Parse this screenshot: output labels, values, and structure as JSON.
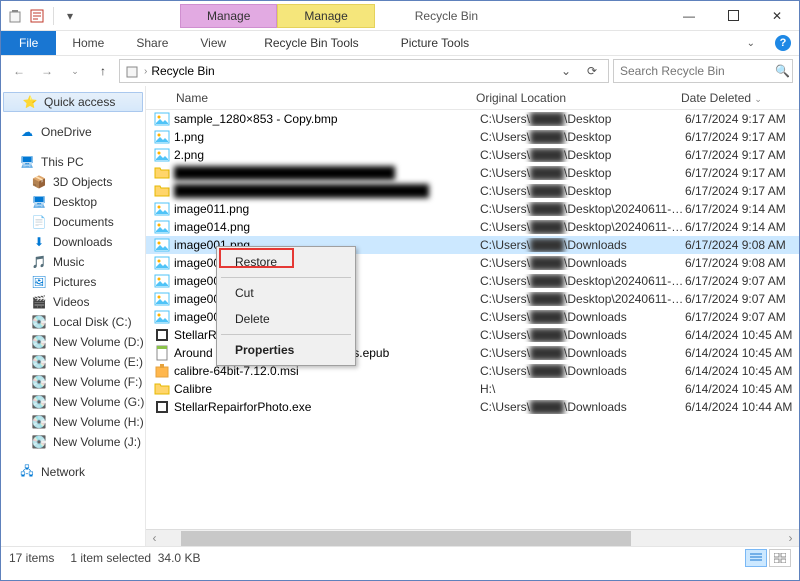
{
  "window": {
    "title": "Recycle Bin"
  },
  "title_tabs": {
    "pink": "Manage",
    "yellow": "Manage"
  },
  "ribbon": {
    "file": "File",
    "home": "Home",
    "share": "Share",
    "view": "View",
    "rbtools": "Recycle Bin Tools",
    "pictools": "Picture Tools"
  },
  "address": {
    "location": "Recycle Bin"
  },
  "search": {
    "placeholder": "Search Recycle Bin"
  },
  "sidebar": {
    "quick_access": "Quick access",
    "onedrive": "OneDrive",
    "this_pc": "This PC",
    "items": [
      "3D Objects",
      "Desktop",
      "Documents",
      "Downloads",
      "Music",
      "Pictures",
      "Videos",
      "Local Disk (C:)",
      "New Volume (D:)",
      "New Volume (E:)",
      "New Volume (F:)",
      "New Volume (G:)",
      "New Volume (H:)",
      "New Volume (J:)"
    ],
    "network": "Network"
  },
  "columns": {
    "name": "Name",
    "loc": "Original Location",
    "date": "Date Deleted"
  },
  "files": [
    {
      "icon": "img",
      "name": "sample_1280×853 - Copy.bmp",
      "loc": "C:\\Users\\████\\Desktop",
      "date": "6/17/2024 9:17 AM"
    },
    {
      "icon": "img",
      "name": "1.png",
      "loc": "C:\\Users\\████\\Desktop",
      "date": "6/17/2024 9:17 AM"
    },
    {
      "icon": "img",
      "name": "2.png",
      "loc": "C:\\Users\\████\\Desktop",
      "date": "6/17/2024 9:17 AM"
    },
    {
      "icon": "folder",
      "name": "██████████████████████████",
      "loc": "C:\\Users\\████\\Desktop",
      "date": "6/17/2024 9:17 AM",
      "blur": true
    },
    {
      "icon": "folder",
      "name": "██████████████████████████████",
      "loc": "C:\\Users\\████\\Desktop",
      "date": "6/17/2024 9:17 AM",
      "blur": true
    },
    {
      "icon": "img",
      "name": "image011.png",
      "loc": "C:\\Users\\████\\Desktop\\20240611-data-re...",
      "date": "6/17/2024 9:14 AM"
    },
    {
      "icon": "img",
      "name": "image014.png",
      "loc": "C:\\Users\\████\\Desktop\\20240611-data-re...",
      "date": "6/17/2024 9:14 AM"
    },
    {
      "icon": "img",
      "name": "image001.png",
      "loc": "C:\\Users\\████\\Downloads",
      "date": "6/17/2024 9:08 AM",
      "sel": true
    },
    {
      "icon": "img",
      "name": "image003",
      "loc": "C:\\Users\\████\\Downloads",
      "date": "6/17/2024 9:08 AM"
    },
    {
      "icon": "img",
      "name": "image001",
      "loc": "C:\\Users\\████\\Desktop\\20240611-data-re...",
      "date": "6/17/2024 9:07 AM"
    },
    {
      "icon": "img",
      "name": "image002",
      "loc": "C:\\Users\\████\\Desktop\\20240611-data-re...",
      "date": "6/17/2024 9:07 AM"
    },
    {
      "icon": "img",
      "name": "image003",
      "loc": "C:\\Users\\████\\Downloads",
      "date": "6/17/2024 9:07 AM"
    },
    {
      "icon": "exe",
      "name": "StellarRep",
      "loc": "C:\\Users\\████\\Downloads",
      "date": "6/14/2024 10:45 AM"
    },
    {
      "icon": "epub",
      "name": "Around the World in 28 Languages.epub",
      "loc": "C:\\Users\\████\\Downloads",
      "date": "6/14/2024 10:45 AM"
    },
    {
      "icon": "msi",
      "name": "calibre-64bit-7.12.0.msi",
      "loc": "C:\\Users\\████\\Downloads",
      "date": "6/14/2024 10:45 AM"
    },
    {
      "icon": "folder",
      "name": "Calibre",
      "loc": "H:\\",
      "date": "6/14/2024 10:45 AM"
    },
    {
      "icon": "exe",
      "name": "StellarRepairforPhoto.exe",
      "loc": "C:\\Users\\████\\Downloads",
      "date": "6/14/2024 10:44 AM"
    }
  ],
  "context": {
    "restore": "Restore",
    "cut": "Cut",
    "delete": "Delete",
    "properties": "Properties"
  },
  "status": {
    "count": "17 items",
    "sel": "1 item selected",
    "size": "34.0 KB"
  }
}
